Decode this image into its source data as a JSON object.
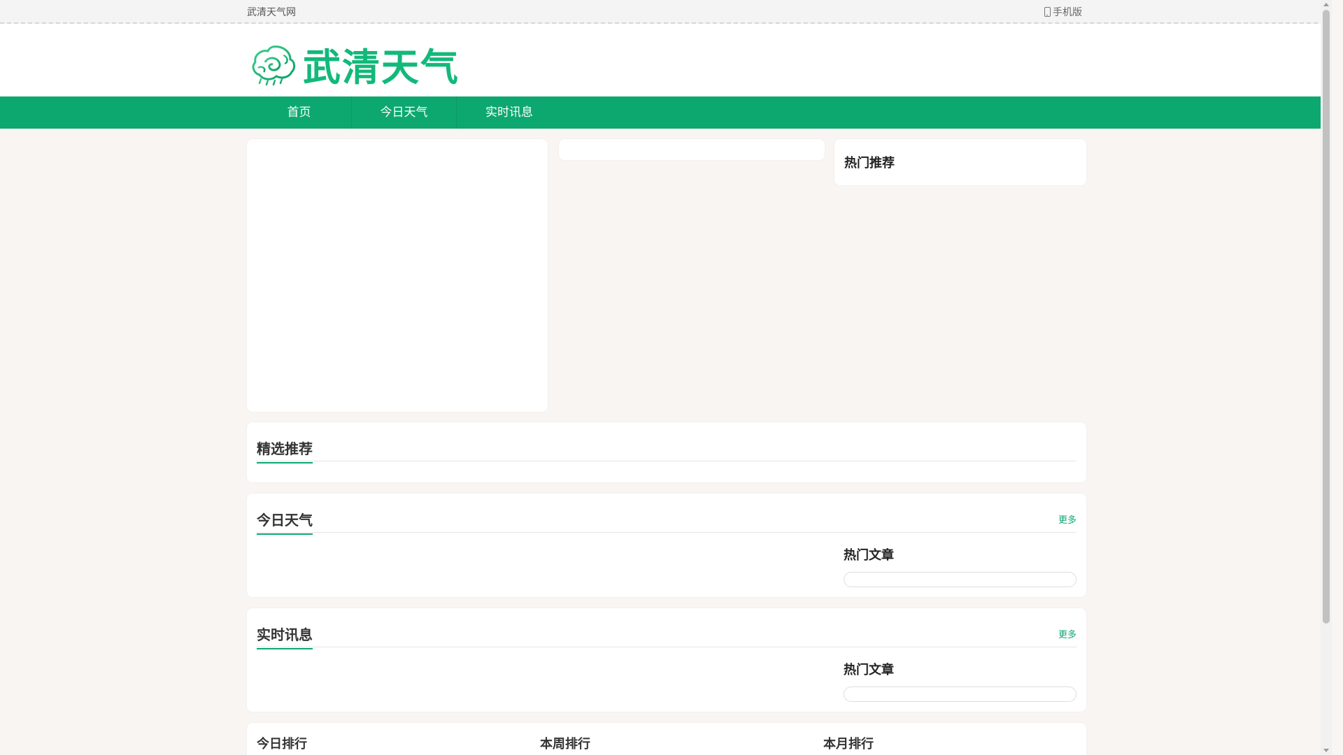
{
  "topbar": {
    "site_name": "武清天气网",
    "mobile_label": "手机版",
    "mobile_icon": "phone-icon"
  },
  "header": {
    "logo_text": "武清天气",
    "logo_icon": "cloud-swirl-logo"
  },
  "nav": {
    "items": [
      {
        "label": "首页"
      },
      {
        "label": "今日天气"
      },
      {
        "label": "实时讯息"
      }
    ]
  },
  "sidebar": {
    "hot_recommend_title": "热门推荐"
  },
  "sections": {
    "featured": {
      "title": "精选推荐"
    },
    "weather": {
      "title": "今日天气",
      "more": "更多",
      "side_title": "热门文章"
    },
    "news": {
      "title": "实时讯息",
      "more": "更多",
      "side_title": "热门文章"
    }
  },
  "ranks": {
    "daily": "今日排行",
    "weekly": "本周排行",
    "monthly": "本月排行"
  },
  "colors": {
    "brand_green": "#0ca86f",
    "logo_green": "#12b97a",
    "page_bg": "#f8f5f2"
  }
}
